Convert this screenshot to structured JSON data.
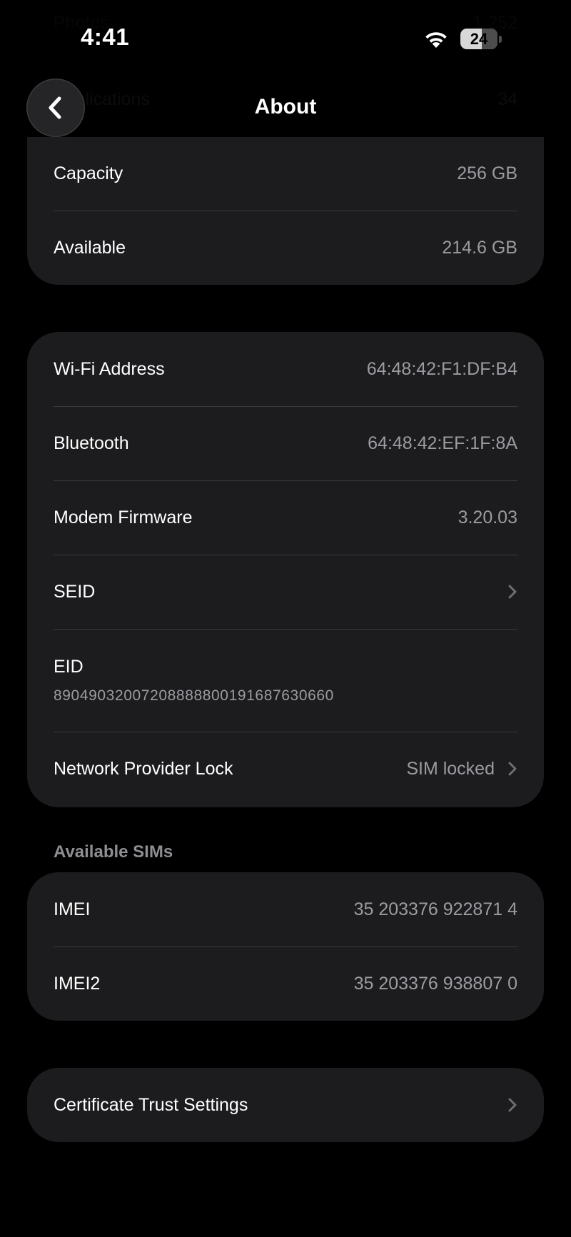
{
  "status_bar": {
    "time": "4:41",
    "battery_level": "24",
    "icons": [
      "wifi-icon",
      "battery-icon"
    ]
  },
  "nav": {
    "title": "About",
    "back_icon": "chevron-left-icon"
  },
  "background_rows": [
    {
      "label": "Photos",
      "value": "1,252"
    },
    {
      "label": "Applications",
      "value": "34"
    }
  ],
  "storage_group": {
    "rows": [
      {
        "label": "Capacity",
        "value": "256 GB"
      },
      {
        "label": "Available",
        "value": "214.6 GB"
      }
    ]
  },
  "network_group": {
    "wifi": {
      "label": "Wi-Fi Address",
      "value": "64:48:42:F1:DF:B4"
    },
    "bluetooth": {
      "label": "Bluetooth",
      "value": "64:48:42:EF:1F:8A"
    },
    "modem": {
      "label": "Modem Firmware",
      "value": "3.20.03"
    },
    "seid": {
      "label": "SEID"
    },
    "eid": {
      "label": "EID",
      "value": "89049032007208888800191687630660"
    },
    "lock": {
      "label": "Network Provider Lock",
      "value": "SIM locked"
    }
  },
  "sims_section": {
    "header": "Available SIMs",
    "rows": [
      {
        "label": "IMEI",
        "value": "35 203376 922871 4"
      },
      {
        "label": "IMEI2",
        "value": "35 203376 938807 0"
      }
    ]
  },
  "certificate": {
    "label": "Certificate Trust Settings"
  },
  "colors": {
    "background": "#000000",
    "group_background": "#1c1c1e",
    "secondary_text": "#9b9ba1",
    "separator": "#3a3a3c"
  }
}
